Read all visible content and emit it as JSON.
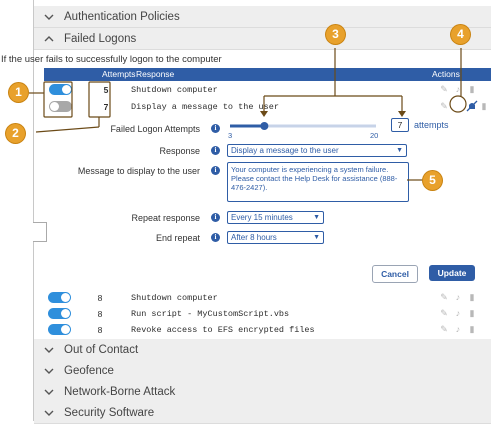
{
  "sections_top": [
    {
      "label": "Authentication Policies"
    },
    {
      "label": "Failed Logons"
    }
  ],
  "intro_text": "If the user fails to successfully logon to the computer",
  "table": {
    "headers": {
      "attempts": "Attempts",
      "response": "Response",
      "actions": "Actions"
    },
    "rows_top": [
      {
        "attempts": "5",
        "response": "Shutdown computer",
        "enabled": true
      },
      {
        "attempts": "7",
        "response": "Display a message to the user",
        "enabled": false
      }
    ],
    "rows_bottom": [
      {
        "attempts": "8",
        "response": "Shutdown computer",
        "enabled": true
      },
      {
        "attempts": "8",
        "response": "Run script - MyCustomScript.vbs",
        "enabled": true
      },
      {
        "attempts": "8",
        "response": "Revoke access to EFS encrypted files",
        "enabled": true
      }
    ]
  },
  "editor": {
    "attempts_label": "Failed Logon Attempts",
    "slider_min": "3",
    "slider_max": "20",
    "slider_value": 7,
    "attempts_value": "7",
    "attempts_suffix": "attempts",
    "response_label": "Response",
    "response_value": "Display a message to the user",
    "message_label": "Message to display to the user",
    "message_value": "Your computer is experiencing a system failure. Please contact the Help Desk for assistance (888-476-2427).",
    "repeat_label": "Repeat response",
    "repeat_value": "Every 15 minutes",
    "end_label": "End repeat",
    "end_value": "After 8 hours",
    "cancel_label": "Cancel",
    "update_label": "Update"
  },
  "sections_bottom": [
    {
      "label": "Out of Contact"
    },
    {
      "label": "Geofence"
    },
    {
      "label": "Network-Borne Attack"
    },
    {
      "label": "Security Software"
    }
  ],
  "callouts": [
    "1",
    "2",
    "3",
    "4",
    "5"
  ],
  "info_glyph": "i",
  "colors": {
    "accent": "#2f5da6",
    "toggle_on": "#2f8fdc",
    "callout": "#e8a12c",
    "header_bg": "#eeeeee"
  }
}
